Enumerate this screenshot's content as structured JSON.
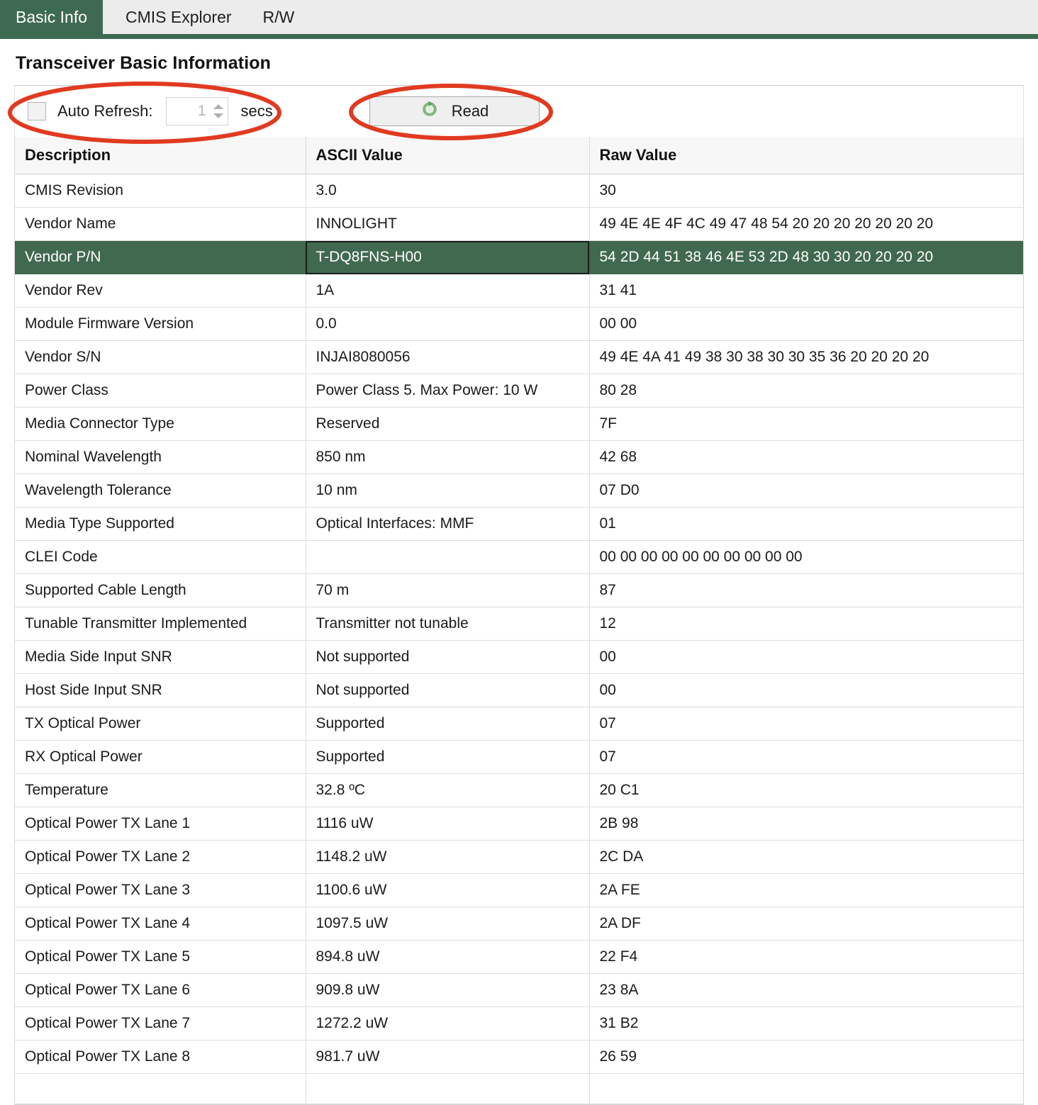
{
  "tabs": [
    {
      "label": "Basic Info",
      "active": true
    },
    {
      "label": "CMIS Explorer",
      "active": false
    },
    {
      "label": "R/W",
      "active": false
    }
  ],
  "page": {
    "title": "Transceiver Basic Information"
  },
  "controls": {
    "auto_refresh_label": "Auto Refresh:",
    "auto_refresh_checked": false,
    "interval_value": "1",
    "secs_label": "secs",
    "read_button_label": "Read",
    "read_icon": "refresh-icon"
  },
  "colors": {
    "accent_green": "#3f6a52",
    "selected_row": "#41694f",
    "annotation_red": "#e03a20",
    "tabstrip_bg": "#ececec"
  },
  "table": {
    "columns": [
      "Description",
      "ASCII Value",
      "Raw Value"
    ],
    "selected_row_index": 2,
    "rows": [
      {
        "description": "CMIS Revision",
        "ascii": "3.0",
        "raw": "30"
      },
      {
        "description": "Vendor Name",
        "ascii": "INNOLIGHT",
        "raw": "49 4E 4E 4F 4C 49 47 48 54 20 20 20 20 20 20 20"
      },
      {
        "description": "Vendor P/N",
        "ascii": "T-DQ8FNS-H00",
        "raw": "54 2D 44 51 38 46 4E 53 2D 48 30 30 20 20 20 20"
      },
      {
        "description": "Vendor Rev",
        "ascii": "1A",
        "raw": "31 41"
      },
      {
        "description": "Module Firmware Version",
        "ascii": "0.0",
        "raw": "00 00"
      },
      {
        "description": "Vendor S/N",
        "ascii": "INJAI8080056",
        "raw": "49 4E 4A 41 49 38 30 38 30 30 35 36 20 20 20 20"
      },
      {
        "description": "Power Class",
        "ascii": "Power Class 5. Max Power: 10 W",
        "raw": "80 28"
      },
      {
        "description": "Media Connector Type",
        "ascii": "Reserved",
        "raw": "7F"
      },
      {
        "description": "Nominal Wavelength",
        "ascii": "850 nm",
        "raw": "42 68"
      },
      {
        "description": "Wavelength Tolerance",
        "ascii": "10 nm",
        "raw": "07 D0"
      },
      {
        "description": "Media Type Supported",
        "ascii": "Optical Interfaces: MMF",
        "raw": "01"
      },
      {
        "description": "CLEI Code",
        "ascii": "",
        "raw": "00 00 00 00 00 00 00 00 00 00"
      },
      {
        "description": "Supported Cable Length",
        "ascii": "70 m",
        "raw": "87"
      },
      {
        "description": "Tunable Transmitter Implemented",
        "ascii": "Transmitter not tunable",
        "raw": "12"
      },
      {
        "description": "Media Side Input SNR",
        "ascii": "Not supported",
        "raw": "00"
      },
      {
        "description": "Host Side Input SNR",
        "ascii": "Not supported",
        "raw": "00"
      },
      {
        "description": "TX Optical Power",
        "ascii": "Supported",
        "raw": "07"
      },
      {
        "description": "RX Optical Power",
        "ascii": "Supported",
        "raw": "07"
      },
      {
        "description": "Temperature",
        "ascii": "32.8 ºC",
        "raw": "20 C1"
      },
      {
        "description": "Optical Power TX Lane 1",
        "ascii": "1116 uW",
        "raw": "2B 98"
      },
      {
        "description": "Optical Power TX Lane 2",
        "ascii": "1148.2 uW",
        "raw": "2C DA"
      },
      {
        "description": "Optical Power TX Lane 3",
        "ascii": "1100.6 uW",
        "raw": "2A FE"
      },
      {
        "description": "Optical Power TX Lane 4",
        "ascii": "1097.5 uW",
        "raw": "2A DF"
      },
      {
        "description": "Optical Power TX Lane 5",
        "ascii": "894.8 uW",
        "raw": "22 F4"
      },
      {
        "description": "Optical Power TX Lane 6",
        "ascii": "909.8 uW",
        "raw": "23 8A"
      },
      {
        "description": "Optical Power TX Lane 7",
        "ascii": "1272.2 uW",
        "raw": "31 B2"
      },
      {
        "description": "Optical Power TX Lane 8",
        "ascii": "981.7 uW",
        "raw": "26 59"
      },
      {
        "description": "",
        "ascii": "",
        "raw": ""
      }
    ]
  },
  "annotations": [
    {
      "name": "auto-refresh-highlight",
      "shape": "ellipse"
    },
    {
      "name": "read-button-highlight",
      "shape": "ellipse"
    }
  ]
}
